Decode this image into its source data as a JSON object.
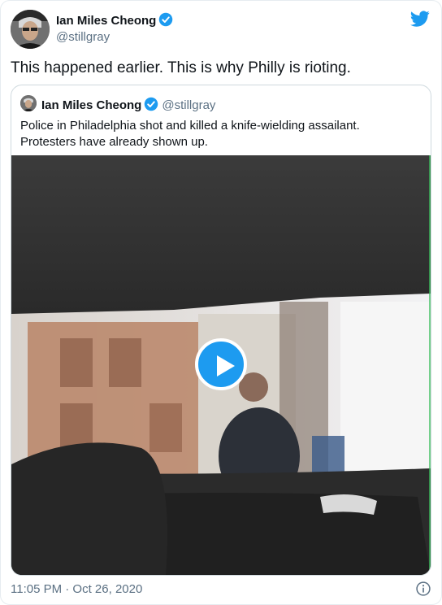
{
  "tweet": {
    "author_name": "Ian Miles Cheong",
    "author_handle": "@stillgray",
    "text": "This happened earlier. This is why Philly is rioting.",
    "timestamp": "11:05 PM · Oct 26, 2020",
    "icons": {
      "verified": "verified-badge-icon",
      "brand": "twitter-bird-icon",
      "info": "info-icon"
    }
  },
  "quoted": {
    "author_name": "Ian Miles Cheong",
    "author_handle": "@stillgray",
    "text": "Police in Philadelphia shot and killed a knife-wielding assailant. Protesters have already shown up.",
    "media": {
      "kind": "video",
      "icon": "play-icon"
    }
  },
  "colors": {
    "accent": "#1d9bf0",
    "secondary_text": "#5b7083",
    "border": "#cfd9de"
  }
}
